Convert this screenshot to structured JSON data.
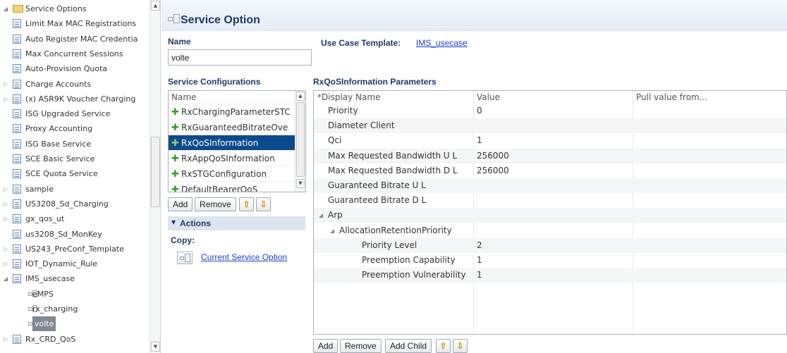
{
  "tree": {
    "items": [
      {
        "label": "Service Options",
        "kind": "folder",
        "twisty": "open"
      },
      {
        "label": "Limit Max MAC Registrations",
        "kind": "doc",
        "twisty": ""
      },
      {
        "label": "Auto Register MAC Credentia",
        "kind": "doc",
        "twisty": ""
      },
      {
        "label": "Max Concurrent Sessions",
        "kind": "doc",
        "twisty": ""
      },
      {
        "label": "Auto-Provision Quota",
        "kind": "doc",
        "twisty": ""
      },
      {
        "label": "Charge Accounts",
        "kind": "doc",
        "twisty": "closed"
      },
      {
        "label": "(x) ASR9K Voucher Charging",
        "kind": "doc",
        "twisty": "closed"
      },
      {
        "label": "ISG Upgraded Service",
        "kind": "doc",
        "twisty": ""
      },
      {
        "label": "Proxy Accounting",
        "kind": "doc",
        "twisty": ""
      },
      {
        "label": "ISG Base Service",
        "kind": "doc",
        "twisty": ""
      },
      {
        "label": "SCE Basic Service",
        "kind": "doc",
        "twisty": ""
      },
      {
        "label": "SCE Quota Service",
        "kind": "doc",
        "twisty": ""
      },
      {
        "label": "sample",
        "kind": "doc",
        "twisty": "closed"
      },
      {
        "label": "US3208_Sd_Charging",
        "kind": "doc",
        "twisty": "closed"
      },
      {
        "label": "gx_qos_ut",
        "kind": "doc",
        "twisty": "closed"
      },
      {
        "label": "us3208_Sd_MonKey",
        "kind": "doc",
        "twisty": ""
      },
      {
        "label": "US243_PreConf_Template",
        "kind": "doc",
        "twisty": "closed"
      },
      {
        "label": "IOT_Dynamic_Rule",
        "kind": "doc",
        "twisty": "closed"
      },
      {
        "label": "IMS_usecase",
        "kind": "doc",
        "twisty": "open"
      },
      {
        "label": "eMPS",
        "kind": "svc",
        "twisty": "",
        "indent": 1
      },
      {
        "label": "rx_charging",
        "kind": "svc",
        "twisty": "",
        "indent": 1
      },
      {
        "label": "volte",
        "kind": "svc",
        "twisty": "",
        "indent": 1,
        "selected": true
      },
      {
        "label": "Rx_CRD_QoS",
        "kind": "doc",
        "twisty": "closed"
      }
    ]
  },
  "header": {
    "title": "Service Option"
  },
  "form": {
    "name_label": "Name",
    "name_value": "volte",
    "use_case_label": "Use Case Template:",
    "use_case_link": "IMS_usecase"
  },
  "service_configurations": {
    "title": "Service Configurations",
    "column_header": "Name",
    "items": [
      {
        "label": "RxChargingParameterSTC"
      },
      {
        "label": "RxGuaranteedBitrateOve"
      },
      {
        "label": "RxQoSInformation",
        "selected": true
      },
      {
        "label": "RxAppQoSInformation"
      },
      {
        "label": "RxSTGConfiguration"
      },
      {
        "label": "DefaultBearerQoS"
      }
    ],
    "buttons": {
      "add": "Add",
      "remove": "Remove",
      "up": "⇧",
      "down": "⇩"
    }
  },
  "actions": {
    "title": "Actions",
    "copy_label": "Copy:",
    "copy_link": "Current Service Option"
  },
  "parameters": {
    "title": "RxQoSInformation Parameters",
    "columns": [
      "*Display Name",
      "Value",
      "Pull value from..."
    ],
    "rows": [
      {
        "name": "Priority",
        "value": "0",
        "level": 0,
        "twisty": ""
      },
      {
        "name": "Diameter Client",
        "value": "",
        "level": 0,
        "twisty": ""
      },
      {
        "name": "Qci",
        "value": "1",
        "level": 0,
        "twisty": ""
      },
      {
        "name": "Max Requested Bandwidth U L",
        "value": "256000",
        "level": 0,
        "twisty": ""
      },
      {
        "name": "Max Requested Bandwidth D L",
        "value": "256000",
        "level": 0,
        "twisty": ""
      },
      {
        "name": "Guaranteed Bitrate U L",
        "value": "",
        "level": 0,
        "twisty": ""
      },
      {
        "name": "Guaranteed Bitrate D L",
        "value": "",
        "level": 0,
        "twisty": ""
      },
      {
        "name": "Arp",
        "value": "",
        "level": 0,
        "twisty": "open"
      },
      {
        "name": "AllocationRetentionPriority",
        "value": "",
        "level": 1,
        "twisty": "open"
      },
      {
        "name": "Priority Level",
        "value": "2",
        "level": 2,
        "twisty": ""
      },
      {
        "name": "Preemption Capability",
        "value": "1",
        "level": 2,
        "twisty": ""
      },
      {
        "name": "Preemption Vulnerability",
        "value": "1",
        "level": 2,
        "twisty": ""
      }
    ],
    "buttons": {
      "add": "Add",
      "remove": "Remove",
      "add_child": "Add Child",
      "up": "⇧",
      "down": "⇩"
    }
  },
  "colors": {
    "accent": "#1f3a6b",
    "selection": "#0c4a8e",
    "link": "#1a3fd0"
  }
}
